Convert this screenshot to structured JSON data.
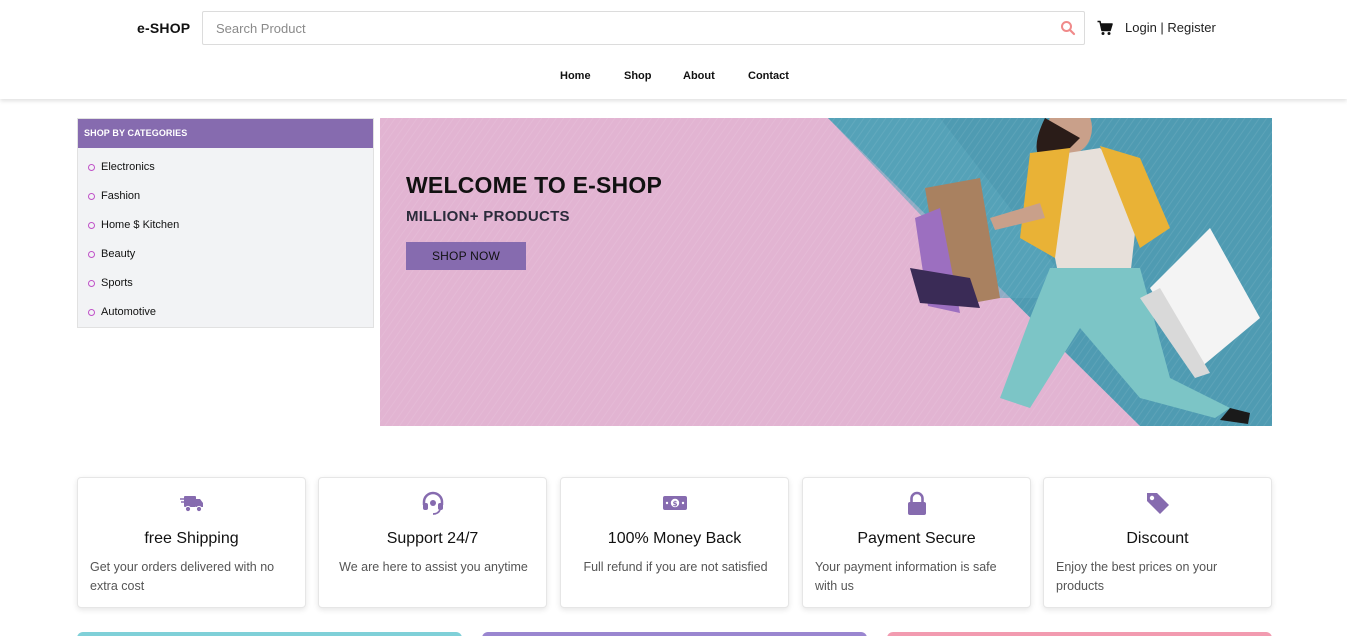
{
  "header": {
    "logo": "e-SHOP",
    "search_placeholder": "Search Product",
    "auth_login": "Login",
    "auth_sep": " | ",
    "auth_register": "Register",
    "nav": [
      "Home",
      "Shop",
      "About",
      "Contact"
    ]
  },
  "categories": {
    "title": "SHOP BY CATEGORIES",
    "items": [
      "Electronics",
      "Fashion",
      "Home $ Kitchen",
      "Beauty",
      "Sports",
      "Automotive"
    ]
  },
  "banner": {
    "title": "WELCOME TO E-SHOP",
    "subtitle": "MILLION+ PRODUCTS",
    "button": "SHOP NOW"
  },
  "features": [
    {
      "icon": "truck-icon",
      "title": "free Shipping",
      "desc": "Get your orders delivered with no extra cost"
    },
    {
      "icon": "headset-icon",
      "title": "Support 24/7",
      "desc": "We are here to assist you anytime"
    },
    {
      "icon": "money-icon",
      "title": "100% Money Back",
      "desc": "Full refund if you are not satisfied"
    },
    {
      "icon": "lock-icon",
      "title": "Payment Secure",
      "desc": "Your payment information is safe with us"
    },
    {
      "icon": "tag-icon",
      "title": "Discount",
      "desc": "Enjoy the best prices on your products"
    }
  ],
  "colors": {
    "accent": "#866baf",
    "banner_pink": "#e2b4d2",
    "banner_teal": "#4f9bb2",
    "search_icon": "#f08a8a",
    "strip_teal": "#7fd0d8",
    "strip_purple": "#9a86d0",
    "strip_pink": "#f29bb0"
  }
}
